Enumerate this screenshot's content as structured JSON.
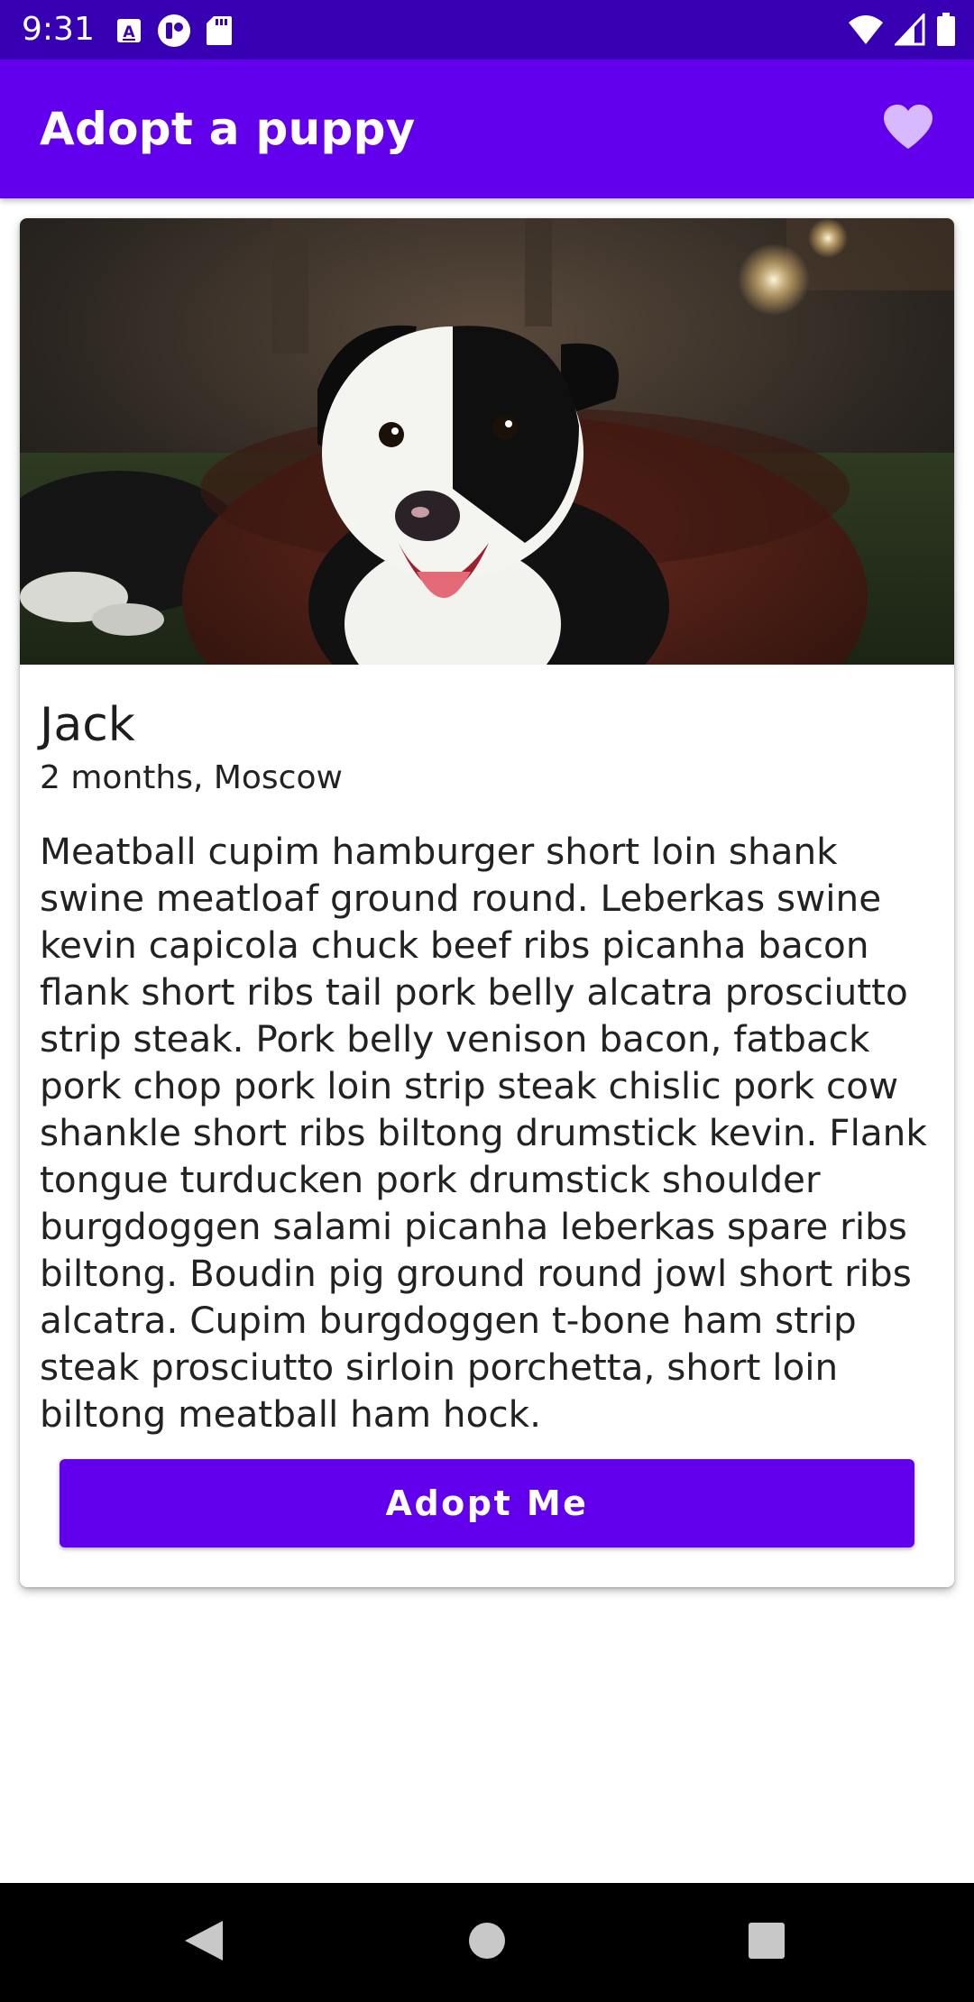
{
  "status_bar": {
    "time": "9:31",
    "left_icons": [
      "app-a-icon",
      "app-badge-icon",
      "sd-card-icon"
    ],
    "right_icons": [
      "wifi-icon",
      "cell-signal-icon",
      "battery-icon"
    ]
  },
  "app_bar": {
    "title": "Adopt a puppy",
    "favorite_icon": "heart-icon"
  },
  "puppy": {
    "photo_icon": "puppy-photo",
    "name": "Jack",
    "meta": "2 months, Moscow",
    "description": "Meatball cupim hamburger short loin shank swine meatloaf ground round. Leberkas swine kevin capicola chuck beef ribs picanha bacon flank short ribs tail pork belly alcatra prosciutto strip steak. Pork belly venison bacon, fatback pork chop pork loin strip steak chislic pork cow shankle short ribs biltong drumstick kevin. Flank tongue turducken pork drumstick shoulder burgdoggen salami picanha leberkas spare ribs biltong. Boudin pig ground round jowl short ribs alcatra. Cupim burgdoggen t-bone ham strip steak prosciutto sirloin porchetta, short loin biltong meatball ham hock.",
    "adopt_label": "Adopt Me"
  },
  "nav_bar": {
    "back_icon": "back-icon",
    "home_icon": "home-icon",
    "recents_icon": "recents-icon"
  },
  "colors": {
    "status_bar": "#3700b3",
    "primary": "#6200ee",
    "heart": "#d7b9ff",
    "nav_bar": "#000000",
    "nav_icons": "#c8c8c8"
  }
}
